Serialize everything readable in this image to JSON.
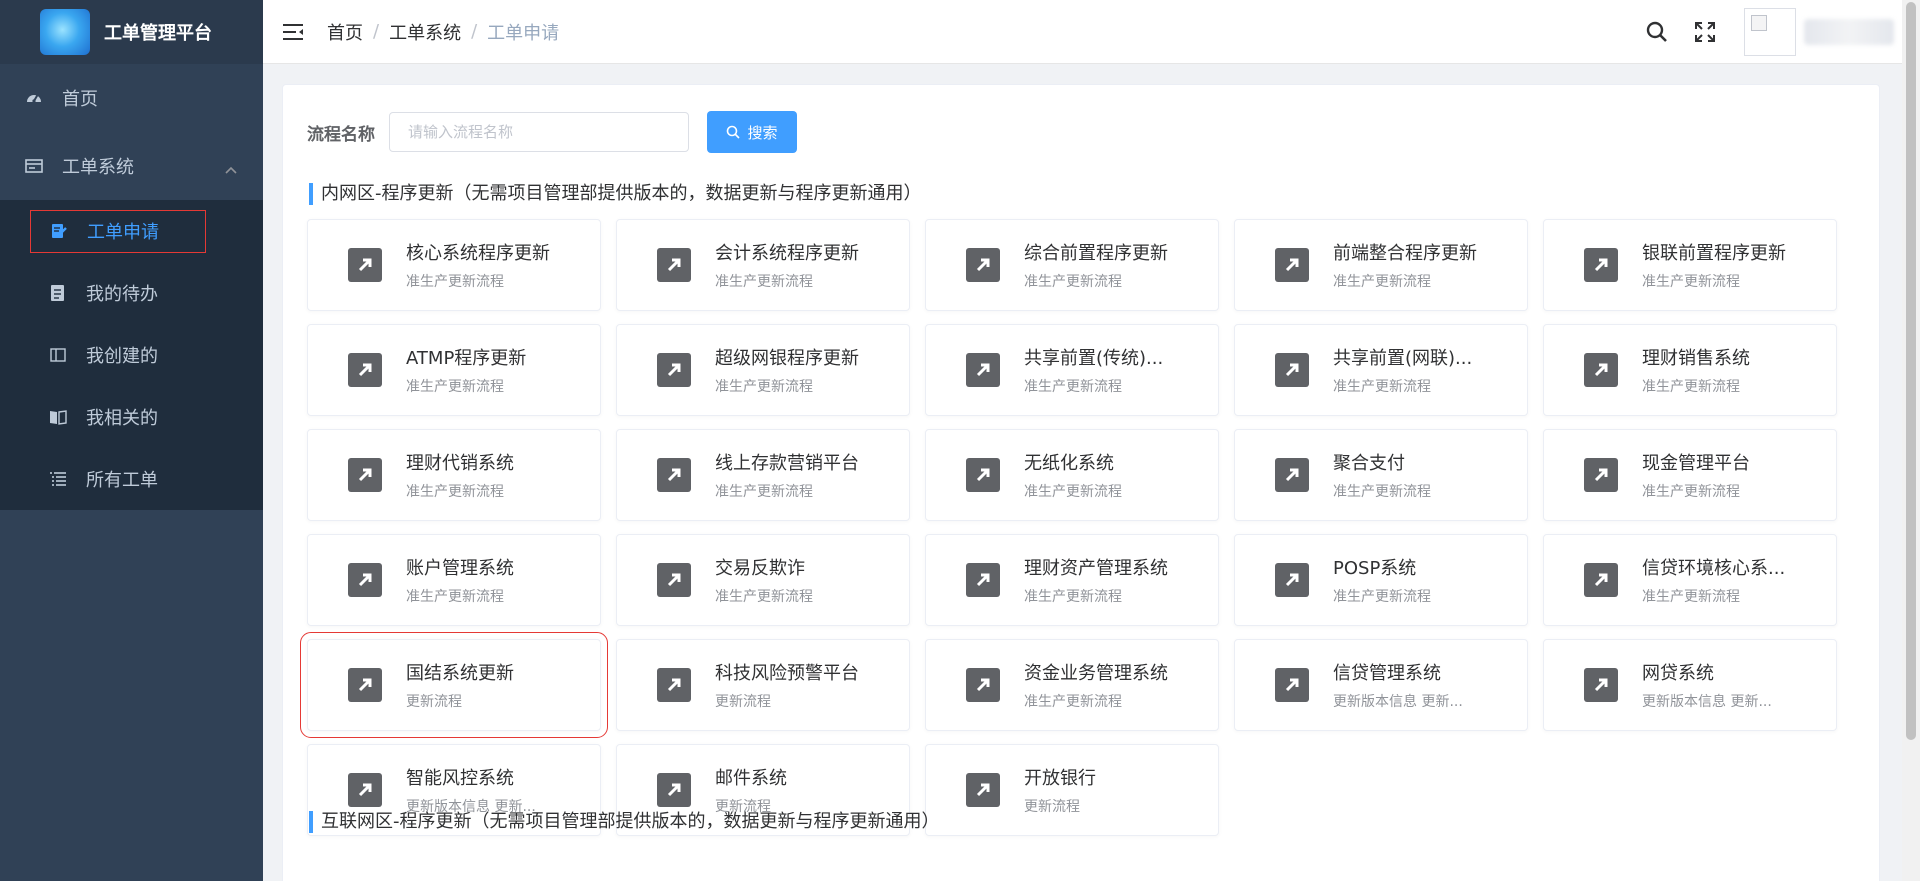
{
  "app": {
    "title": "工单管理平台"
  },
  "sidebar": {
    "home": {
      "label": "首页",
      "icon": "dashboard-icon"
    },
    "group": {
      "label": "工单系统",
      "icon": "workorder-icon"
    },
    "items": [
      {
        "label": "工单申请",
        "icon": "apply-icon",
        "active": true
      },
      {
        "label": "我的待办",
        "icon": "todo-icon"
      },
      {
        "label": "我创建的",
        "icon": "created-icon"
      },
      {
        "label": "我相关的",
        "icon": "related-icon"
      },
      {
        "label": "所有工单",
        "icon": "list-icon"
      }
    ]
  },
  "header": {
    "breadcrumb": [
      "首页",
      "工单系统",
      "工单申请"
    ],
    "separator": "/"
  },
  "search": {
    "label": "流程名称",
    "placeholder": "请输入流程名称",
    "value": "",
    "button_label": "搜索"
  },
  "sections": [
    {
      "title": "内网区-程序更新（无需项目管理部提供版本的，数据更新与程序更新通用）",
      "cards": [
        {
          "name": "核心系统程序更新",
          "desc": "准生产更新流程"
        },
        {
          "name": "会计系统程序更新",
          "desc": "准生产更新流程"
        },
        {
          "name": "综合前置程序更新",
          "desc": "准生产更新流程"
        },
        {
          "name": "前端整合程序更新",
          "desc": "准生产更新流程"
        },
        {
          "name": "银联前置程序更新",
          "desc": "准生产更新流程"
        },
        {
          "name": "ATMP程序更新",
          "desc": "准生产更新流程"
        },
        {
          "name": "超级网银程序更新",
          "desc": "准生产更新流程"
        },
        {
          "name": "共享前置(传统)...",
          "desc": "准生产更新流程"
        },
        {
          "name": "共享前置(网联)...",
          "desc": "准生产更新流程"
        },
        {
          "name": "理财销售系统",
          "desc": "准生产更新流程"
        },
        {
          "name": "理财代销系统",
          "desc": "准生产更新流程"
        },
        {
          "name": "线上存款营销平台",
          "desc": "准生产更新流程"
        },
        {
          "name": "无纸化系统",
          "desc": "准生产更新流程"
        },
        {
          "name": "聚合支付",
          "desc": "准生产更新流程"
        },
        {
          "name": "现金管理平台",
          "desc": "准生产更新流程"
        },
        {
          "name": "账户管理系统",
          "desc": "准生产更新流程"
        },
        {
          "name": "交易反欺诈",
          "desc": "准生产更新流程"
        },
        {
          "name": "理财资产管理系统",
          "desc": "准生产更新流程"
        },
        {
          "name": "POSP系统",
          "desc": "准生产更新流程"
        },
        {
          "name": "信贷环境核心系...",
          "desc": "准生产更新流程"
        },
        {
          "name": "国结系统更新",
          "desc": "更新流程",
          "selected": true
        },
        {
          "name": "科技风险预警平台",
          "desc": "更新流程"
        },
        {
          "name": "资金业务管理系统",
          "desc": "准生产更新流程"
        },
        {
          "name": "信贷管理系统",
          "desc": "更新版本信息 更新..."
        },
        {
          "name": "网贷系统",
          "desc": "更新版本信息 更新..."
        },
        {
          "name": "智能风控系统",
          "desc": "更新版本信息 更新..."
        },
        {
          "name": "邮件系统",
          "desc": "更新流程"
        },
        {
          "name": "开放银行",
          "desc": "更新流程"
        }
      ]
    },
    {
      "title": "互联网区-程序更新（无需项目管理部提供版本的，数据更新与程序更新通用）",
      "cards": []
    }
  ],
  "colors": {
    "accent": "#409eff",
    "sidebar_bg": "#304156",
    "submenu_bg": "#1f2d3d",
    "highlight_border": "#e53935"
  }
}
